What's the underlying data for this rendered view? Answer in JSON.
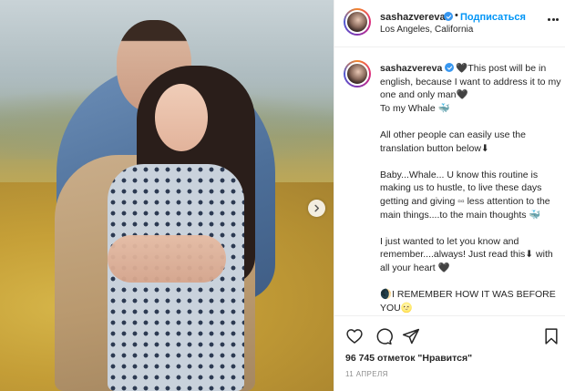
{
  "post": {
    "photo_alt": "",
    "next_icon": "chevron-right-icon"
  },
  "header": {
    "username": "sashazvereva",
    "separator": "•",
    "follow_label": "Подписаться",
    "location": "Los Angeles, California"
  },
  "caption": {
    "username": "sashazvereva",
    "lines": [
      "🖤This post will be in english, because I want to address it to my one and only man🖤",
      "To my Whale 🐳",
      "",
      "All other people can easily use the translation button below⬇",
      "",
      "Baby...Whale... U know this routine is making us to hustle, to live these days getting and giving ▫▫ less attention to the main things....to the main thoughts 🐳",
      "",
      "I just wanted to let you know and remember....always! Just read this⬇ with all your heart 🖤",
      "",
      "🌒I REMEMBER HOW IT WAS BEFORE YOU🌝"
    ]
  },
  "actions": {
    "likes": "96 745 отметок \"Нравится\"",
    "date": "11 АПРЕЛЯ"
  },
  "colors": {
    "accent": "#0095f6",
    "verified": "#3897f0",
    "text": "#262626",
    "muted": "#8e8e8e"
  }
}
